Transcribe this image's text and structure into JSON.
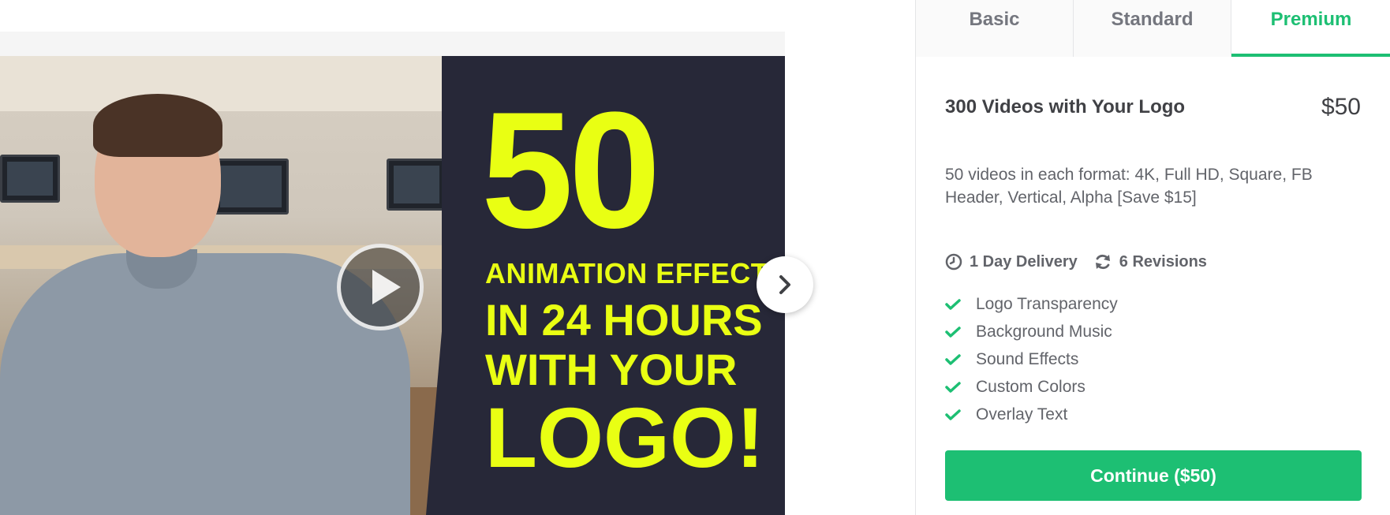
{
  "media": {
    "promo_number": "50",
    "promo_line1": "ANIMATION EFFECTS",
    "promo_line2": "IN 24 HOURS",
    "promo_line3": "WITH YOUR",
    "promo_line4": "LOGO!"
  },
  "package": {
    "tabs": [
      {
        "label": "Basic",
        "active": false
      },
      {
        "label": "Standard",
        "active": false
      },
      {
        "label": "Premium",
        "active": true
      }
    ],
    "title": "300 Videos with Your Logo",
    "price": "$50",
    "description": "50 videos in each format: 4K, Full HD, Square, FB Header, Vertical, Alpha [Save $15]",
    "delivery": {
      "icon": "clock-icon",
      "label": "1 Day Delivery"
    },
    "revisions": {
      "icon": "refresh-icon",
      "label": "6 Revisions"
    },
    "features": [
      "Logo Transparency",
      "Background Music",
      "Sound Effects",
      "Custom Colors",
      "Overlay Text"
    ],
    "cta_label": "Continue ($50)"
  },
  "colors": {
    "accent": "#1dbf73",
    "promo_yellow": "#e9ff13",
    "promo_bg": "#272838",
    "text_dark": "#404145",
    "text_muted": "#62646a"
  }
}
